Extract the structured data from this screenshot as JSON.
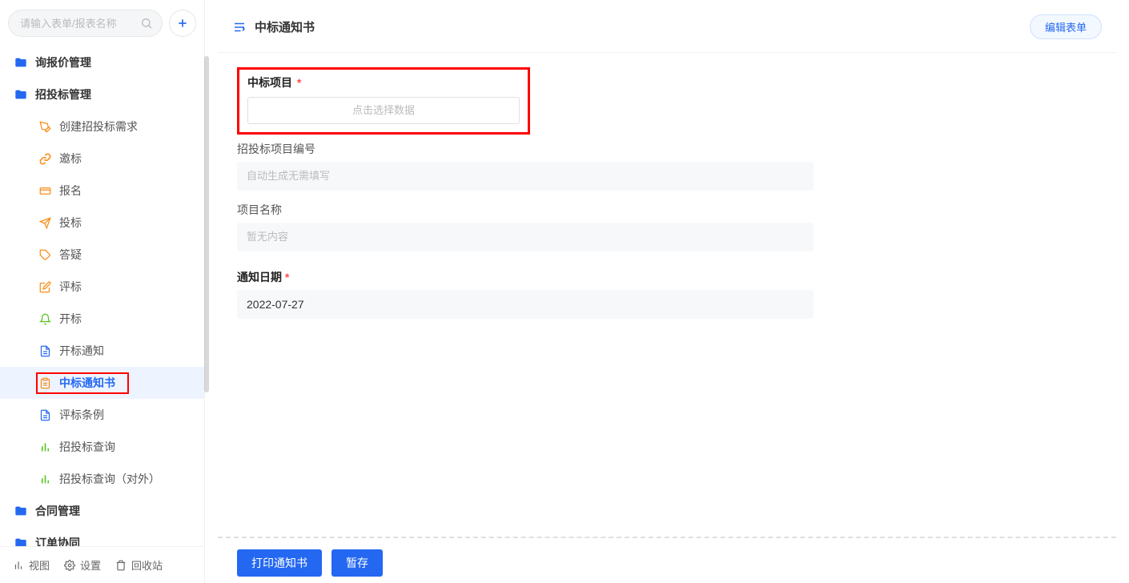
{
  "search": {
    "placeholder": "请输入表单/报表名称"
  },
  "sidebar": {
    "groups": [
      {
        "label": "询报价管理"
      },
      {
        "label": "招投标管理"
      },
      {
        "label": "合同管理"
      },
      {
        "label": "订单协同"
      }
    ],
    "items": [
      {
        "label": "创建招投标需求"
      },
      {
        "label": "邀标"
      },
      {
        "label": "报名"
      },
      {
        "label": "投标"
      },
      {
        "label": "答疑"
      },
      {
        "label": "评标"
      },
      {
        "label": "开标"
      },
      {
        "label": "开标通知"
      },
      {
        "label": "中标通知书"
      },
      {
        "label": "评标条例"
      },
      {
        "label": "招投标查询"
      },
      {
        "label": "招投标查询（对外）"
      }
    ]
  },
  "footer": {
    "view": "视图",
    "settings": "设置",
    "trash": "回收站"
  },
  "page": {
    "title": "中标通知书",
    "edit_label": "编辑表单"
  },
  "form": {
    "proj_label": "中标项目",
    "picker_placeholder": "点击选择数据",
    "number_label": "招投标项目编号",
    "number_placeholder": "自动生成无需填写",
    "name_label": "项目名称",
    "name_placeholder": "暂无内容",
    "date_label": "通知日期",
    "date_value": "2022-07-27"
  },
  "actions": {
    "print": "打印通知书",
    "save": "暂存"
  }
}
